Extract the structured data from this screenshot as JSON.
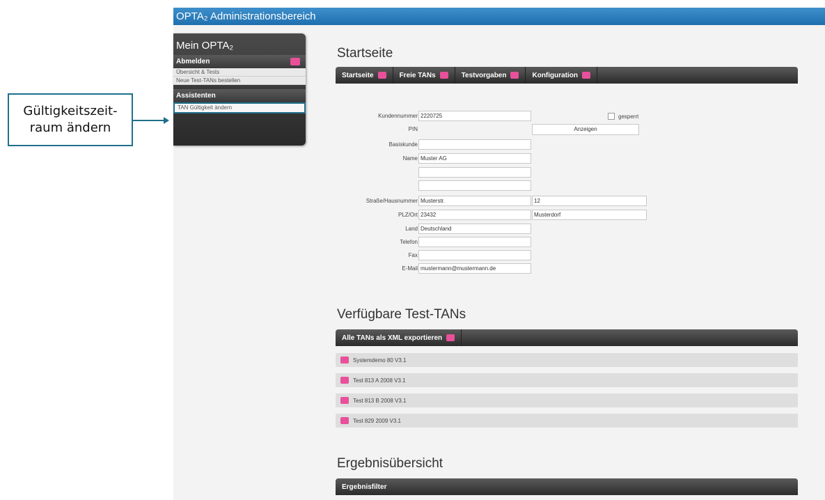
{
  "callout": {
    "line1": "Gültigkeitszeit-",
    "line2": "raum ändern"
  },
  "window": {
    "title": "OPTA₂ Administrationsbereich"
  },
  "sidebar": {
    "title": "Mein OPTA₂",
    "section1": {
      "label": "Abmelden",
      "items": [
        "Übersicht & Tests",
        "Neue Test-TANs bestellen"
      ]
    },
    "section2": {
      "label": "Assistenten",
      "items": [
        "TAN Gültigkeit ändern"
      ]
    }
  },
  "startseite": {
    "heading": "Startseite",
    "menu": [
      "Startseite",
      "Freie TANs",
      "Testvorgaben",
      "Konfiguration"
    ]
  },
  "form": {
    "kundennummer": {
      "label": "Kundennummer",
      "value": "2220725"
    },
    "gesperrt": {
      "label": "gesperrt"
    },
    "pin": {
      "label": "PIN",
      "button": "Anzeigen"
    },
    "basiskunde": {
      "label": "Basiskunde",
      "value": ""
    },
    "name": {
      "label": "Name",
      "value": "Muster AG",
      "extra1": "",
      "extra2": ""
    },
    "strasse": {
      "label": "Straße/Hausnummer",
      "value": "Musterstr.",
      "nr": "12"
    },
    "plzort": {
      "label": "PLZ/Ort",
      "plz": "23432",
      "ort": "Musterdorf"
    },
    "land": {
      "label": "Land",
      "value": "Deutschland"
    },
    "telefon": {
      "label": "Telefon",
      "value": ""
    },
    "fax": {
      "label": "Fax",
      "value": ""
    },
    "email": {
      "label": "E-Mail",
      "value": "mustermann@mustermann.de"
    }
  },
  "tans": {
    "heading": "Verfügbare Test-TANs",
    "export": "Alle TANs als XML exportieren",
    "items": [
      "Systemdemo 80 V3.1",
      "Test 813 A 2008 V3.1",
      "Test 813 B 2008 V3.1",
      "Test 829 2009 V3.1"
    ]
  },
  "ergebnis": {
    "heading": "Ergebnisübersicht",
    "filter": "Ergebnisfilter"
  },
  "colors": {
    "accent": "#e8509a",
    "titlebar": "#1f6fae",
    "callout_border": "#1f6f8b"
  }
}
